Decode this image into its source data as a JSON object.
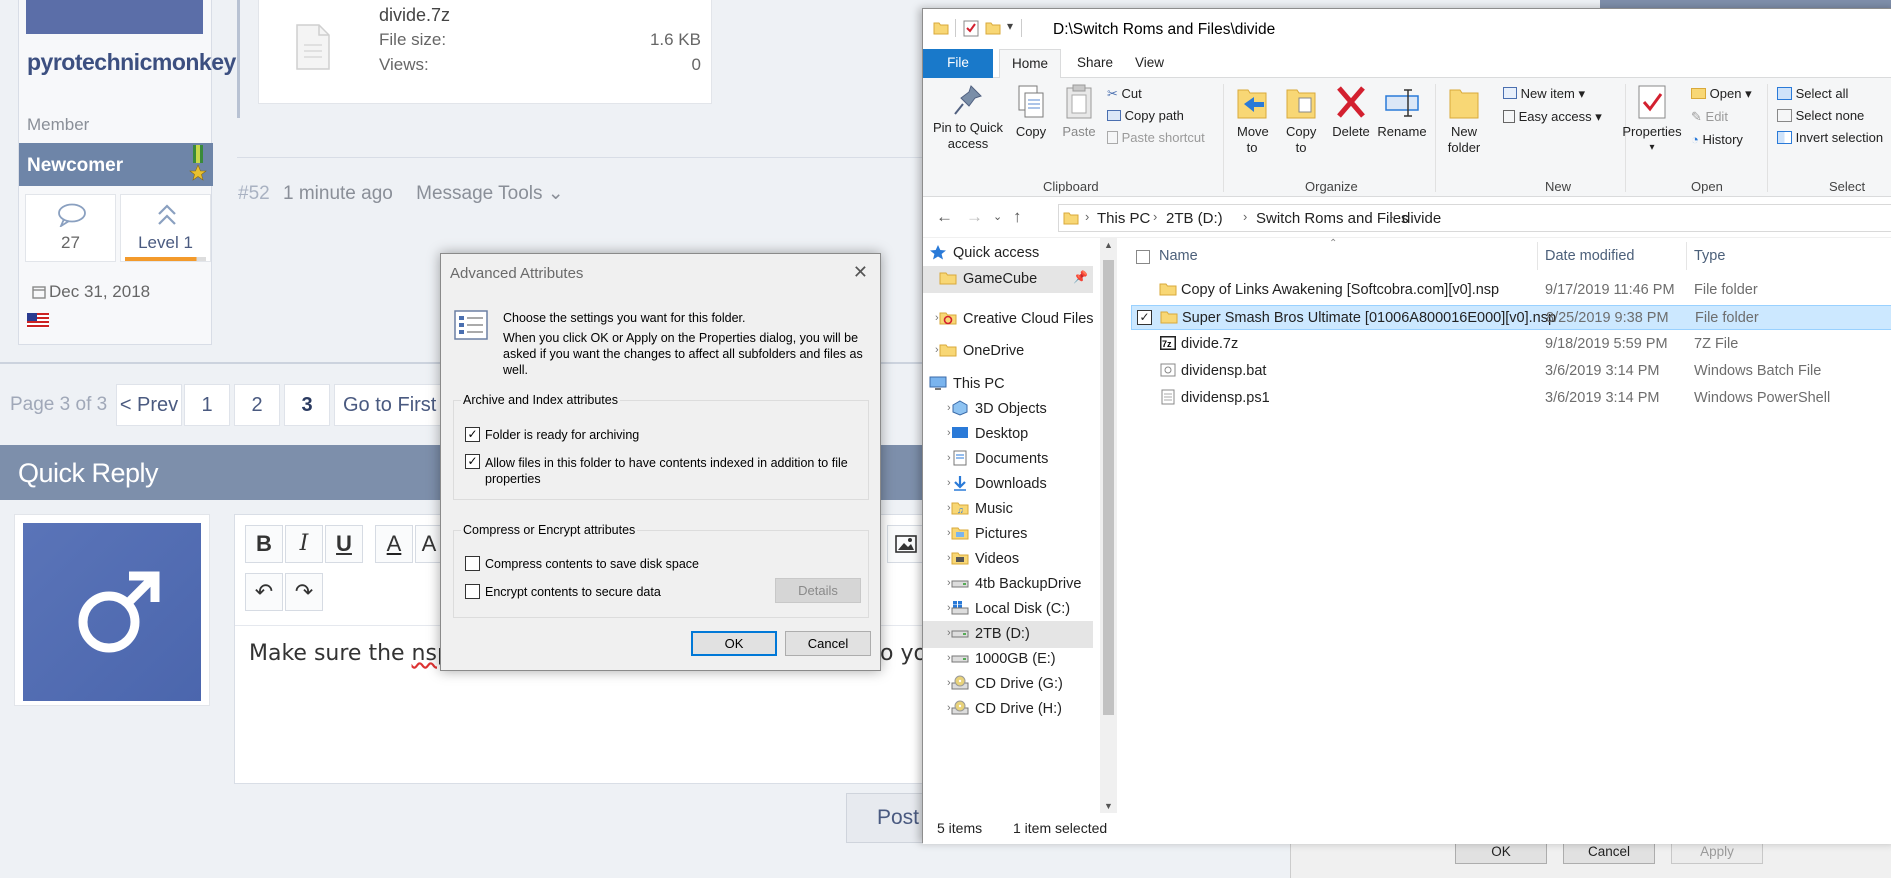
{
  "forum": {
    "username": "pyrotechnicmonkey",
    "user_title": "Member",
    "rank": "Newcomer",
    "stats": {
      "posts": "27",
      "level": "Level 1"
    },
    "join_date": "Dec 31, 2018",
    "attachment": {
      "name": "divide.7z",
      "size_label": "File size:",
      "size_value": "1.6 KB",
      "views_label": "Views:",
      "views_value": "0"
    },
    "post_meta": {
      "number": "#52",
      "time": "1 minute ago",
      "tools": "Message Tools"
    },
    "pager": {
      "label": "Page 3 of 3",
      "prev": "< Prev",
      "pages": [
        "1",
        "2",
        "3"
      ],
      "first": "Go to First"
    },
    "quick_reply_title": "Quick Reply",
    "editor": {
      "bold": "B",
      "italic": "I",
      "underline": "U",
      "color": "A",
      "font": "A",
      "text_before": "Make sure the ",
      "text_misspelled": "nsp",
      "text_after_fragment": "o yo"
    },
    "post_button": "Post"
  },
  "advanced_attributes": {
    "title": "Advanced Attributes",
    "intro_line1": "Choose the settings you want for this folder.",
    "intro_line2": "When you click OK or Apply on the Properties dialog, you will be asked if you want the changes to affect all subfolders and files as well.",
    "archive_group": "Archive and Index attributes",
    "folder_ready": "Folder is ready for archiving",
    "allow_index": "Allow files in this folder to have contents indexed in addition to file properties",
    "compress_group": "Compress or Encrypt attributes",
    "compress": "Compress contents to save disk space",
    "encrypt": "Encrypt contents to secure data",
    "details": "Details",
    "ok": "OK",
    "cancel": "Cancel"
  },
  "explorer": {
    "path": "D:\\Switch Roms and Files\\divide",
    "tabs": {
      "file": "File",
      "home": "Home",
      "share": "Share",
      "view": "View"
    },
    "ribbon": {
      "pin": "Pin to Quick access",
      "copy": "Copy",
      "paste": "Paste",
      "cut": "Cut",
      "copy_path": "Copy path",
      "paste_shortcut": "Paste shortcut",
      "clipboard": "Clipboard",
      "move_to": "Move to",
      "copy_to": "Copy to",
      "delete": "Delete",
      "rename": "Rename",
      "organize": "Organize",
      "new_folder": "New folder",
      "new_item": "New item",
      "easy_access": "Easy access",
      "new": "New",
      "properties": "Properties",
      "open": "Open",
      "edit": "Edit",
      "history": "History",
      "open_group": "Open",
      "select_all": "Select all",
      "select_none": "Select none",
      "invert_selection": "Invert selection",
      "select_group": "Select"
    },
    "breadcrumbs": [
      "This PC",
      "2TB (D:)",
      "Switch Roms and Files",
      "divide"
    ],
    "nav": [
      {
        "label": "Quick access"
      },
      {
        "label": "GameCube"
      },
      {
        "label": "Creative Cloud Files"
      },
      {
        "label": "OneDrive"
      },
      {
        "label": "This PC"
      },
      {
        "label": "3D Objects"
      },
      {
        "label": "Desktop"
      },
      {
        "label": "Documents"
      },
      {
        "label": "Downloads"
      },
      {
        "label": "Music"
      },
      {
        "label": "Pictures"
      },
      {
        "label": "Videos"
      },
      {
        "label": "4tb BackupDrive"
      },
      {
        "label": "Local Disk (C:)"
      },
      {
        "label": "2TB (D:)"
      },
      {
        "label": "1000GB (E:)"
      },
      {
        "label": "CD Drive (G:)"
      },
      {
        "label": "CD Drive (H:)"
      }
    ],
    "columns": {
      "name": "Name",
      "date": "Date modified",
      "type": "Type"
    },
    "files": [
      {
        "name": "Copy of Links Awakening [Softcobra.com][v0].nsp",
        "date": "9/17/2019 11:46 PM",
        "type": "File folder",
        "icon": "folder-icon"
      },
      {
        "name": "Super Smash Bros Ultimate [01006A800016E000][v0].nsp",
        "date": "8/25/2019 9:38 PM",
        "type": "File folder",
        "icon": "folder-icon"
      },
      {
        "name": "divide.7z",
        "date": "9/18/2019 5:59 PM",
        "type": "7Z File",
        "icon": "archive-icon"
      },
      {
        "name": "dividensp.bat",
        "date": "3/6/2019 3:14 PM",
        "type": "Windows Batch File",
        "icon": "batch-file-icon"
      },
      {
        "name": "dividensp.ps1",
        "date": "3/6/2019 3:14 PM",
        "type": "Windows PowerShell",
        "icon": "powershell-icon"
      }
    ],
    "status": {
      "count": "5 items",
      "selected": "1 item selected"
    }
  },
  "properties_buttons": {
    "ok": "OK",
    "cancel": "Cancel",
    "apply": "Apply"
  },
  "colors": {
    "accent": "#1979ca",
    "selection": "#cce8ff",
    "forum_header": "#7d8fab",
    "delete_red": "#d3202f"
  }
}
